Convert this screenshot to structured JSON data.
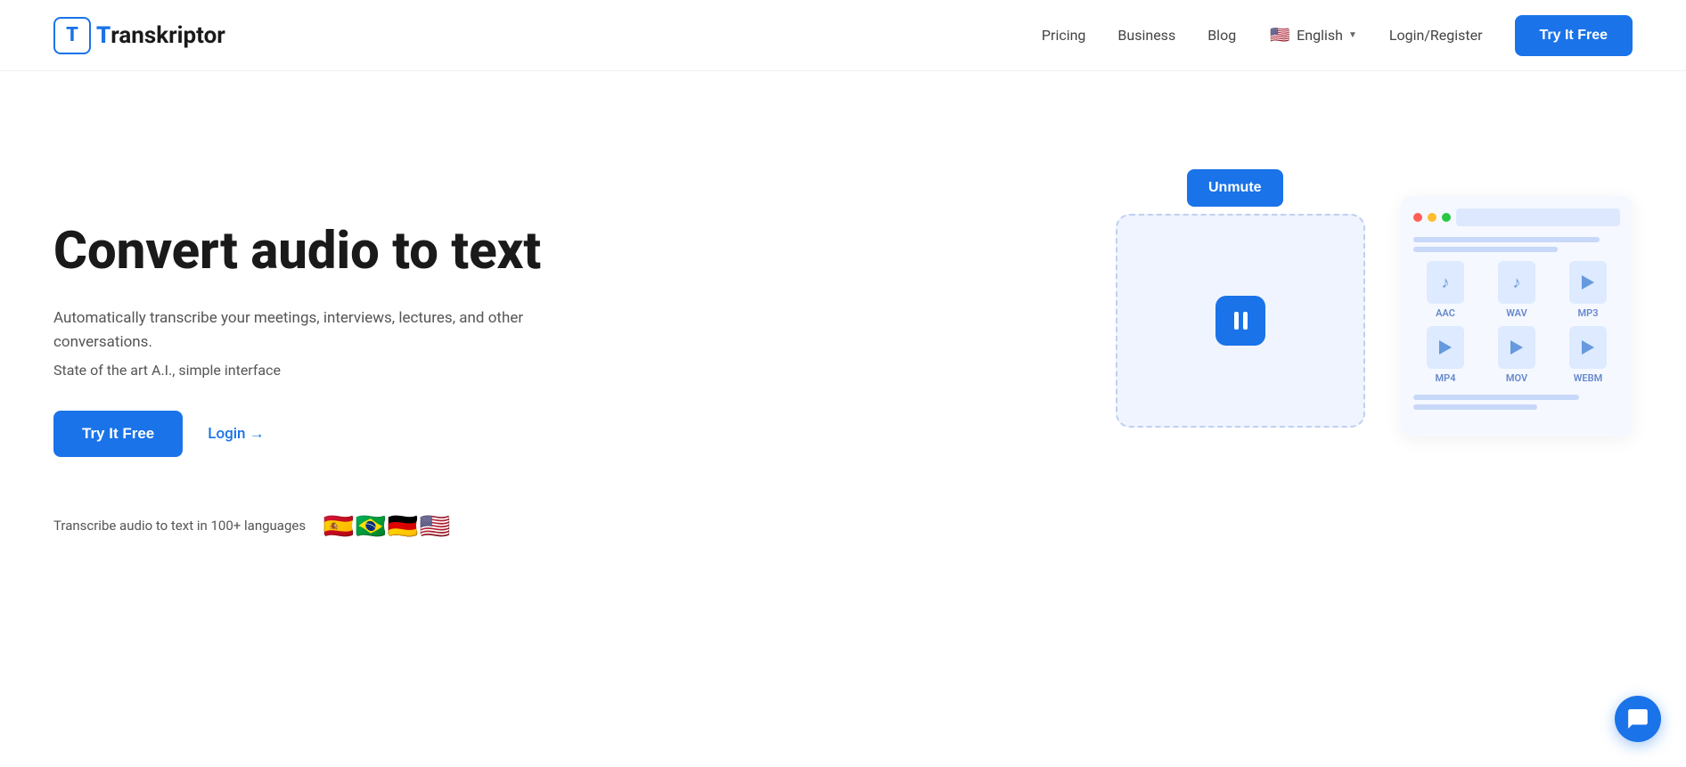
{
  "brand": {
    "logo_letter": "T",
    "name_prefix": "ranskriptor"
  },
  "navbar": {
    "pricing_label": "Pricing",
    "business_label": "Business",
    "blog_label": "Blog",
    "language_label": "English",
    "language_flag": "🇺🇸",
    "login_label": "Login/Register",
    "cta_label": "Try It Free"
  },
  "hero": {
    "title": "Convert audio to text",
    "subtitle": "Automatically transcribe your meetings, interviews, lectures, and other conversations.",
    "tagline": "State of the art A.I., simple interface",
    "cta_primary": "Try It Free",
    "cta_login": "Login →",
    "languages_text": "Transcribe audio to text in 100+ languages",
    "flags": [
      "🇪🇸",
      "🇧🇷",
      "🇩🇪",
      "🇺🇸"
    ],
    "unmute_label": "Unmute",
    "file_formats": [
      {
        "label": "AAC",
        "type": "note"
      },
      {
        "label": "WAV",
        "type": "note"
      },
      {
        "label": "MP3",
        "type": "play"
      },
      {
        "label": "MP4",
        "type": "play"
      },
      {
        "label": "MOV",
        "type": "play"
      },
      {
        "label": "WEBM",
        "type": "play"
      }
    ]
  }
}
